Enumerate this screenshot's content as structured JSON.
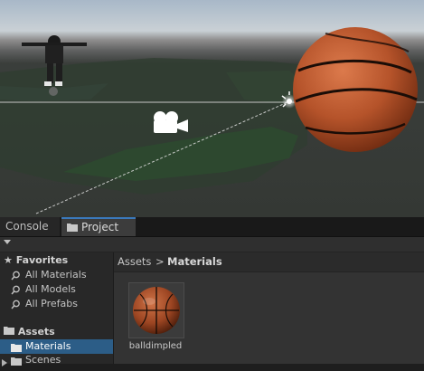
{
  "tabs": [
    {
      "label": "Console",
      "icon": "none"
    },
    {
      "label": "Project",
      "icon": "folder-icon"
    }
  ],
  "favorites": {
    "title": "Favorites",
    "items": [
      "All Materials",
      "All Models",
      "All Prefabs"
    ]
  },
  "assets_tree": {
    "title": "Assets",
    "items": [
      {
        "label": "Materials",
        "selected": true
      },
      {
        "label": "Scenes",
        "selected": false
      }
    ]
  },
  "breadcrumb": {
    "root": "Assets",
    "separator": ">",
    "current": "Materials"
  },
  "assets": [
    {
      "name": "balldimpled",
      "type": "material"
    }
  ],
  "colors": {
    "selection": "#2c5d87",
    "tab_accent": "#3a79bb",
    "ball": "#b8552b"
  }
}
